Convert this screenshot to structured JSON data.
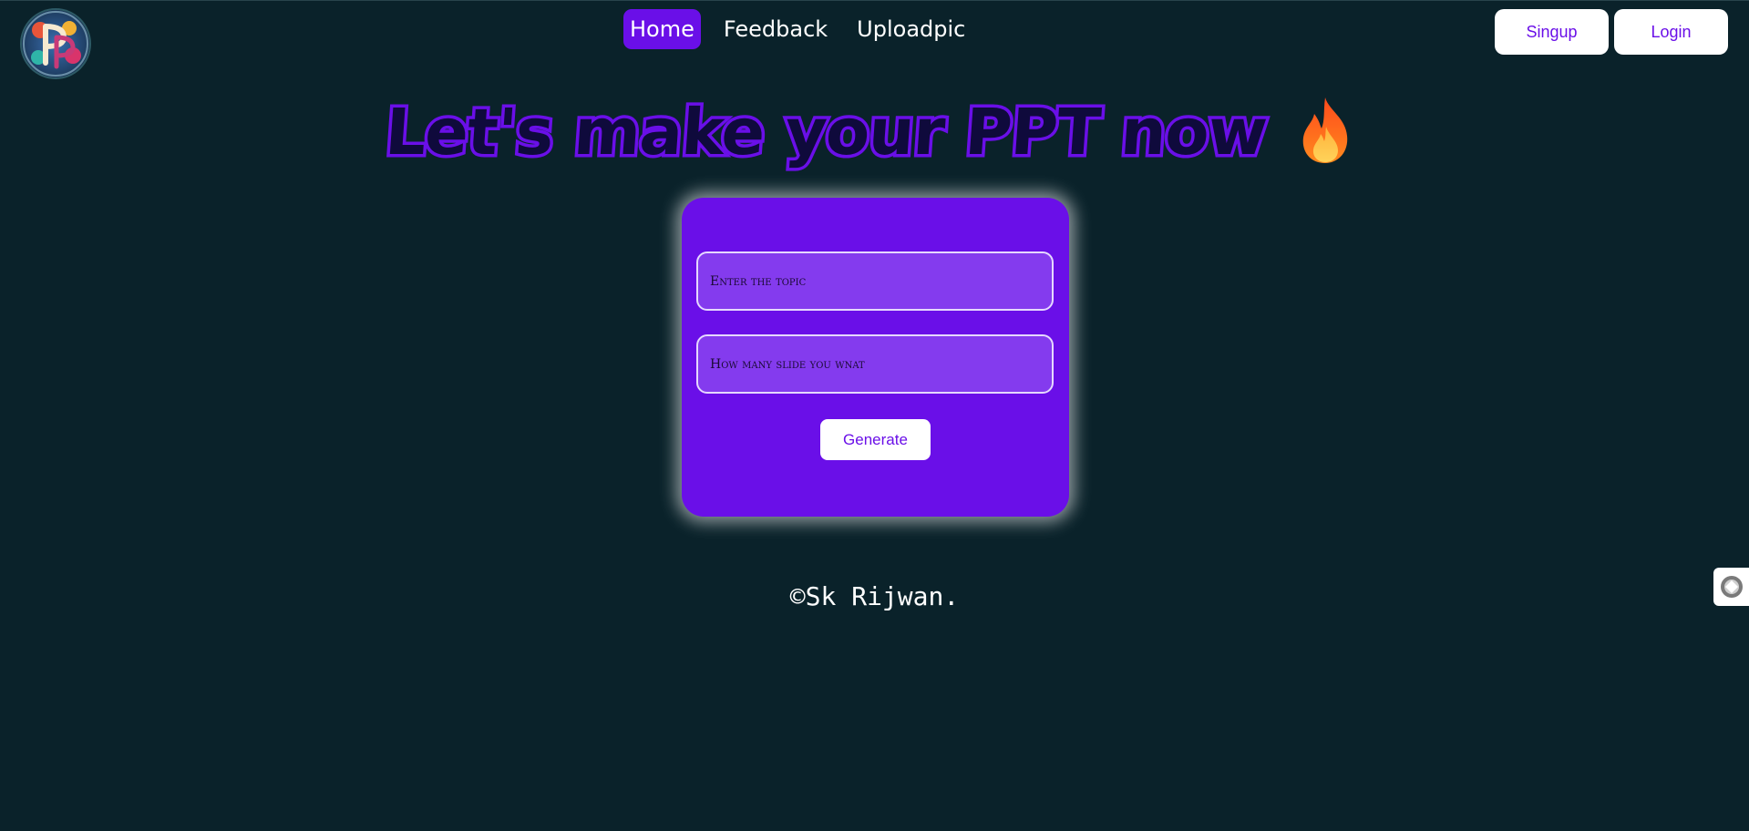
{
  "header": {
    "logo_alt": "PPT logo",
    "nav": [
      {
        "label": "Home",
        "active": true
      },
      {
        "label": "Feedback",
        "active": false
      },
      {
        "label": "Uploadpic",
        "active": false
      }
    ],
    "signup_label": "Singup",
    "login_label": "Login"
  },
  "hero": {
    "title": "Let's make your PPT now",
    "icon": "flame-icon"
  },
  "form": {
    "topic_placeholder": "Enter the topic",
    "topic_value": "",
    "slides_placeholder": "How many slide you wnat",
    "slides_value": "",
    "generate_label": "Generate"
  },
  "footer": {
    "copyright": "©Sk Rijwan."
  },
  "colors": {
    "background": "#0a222a",
    "accent": "#6a0fe8",
    "field_bg": "#843bee",
    "text_light": "#ffffff"
  }
}
